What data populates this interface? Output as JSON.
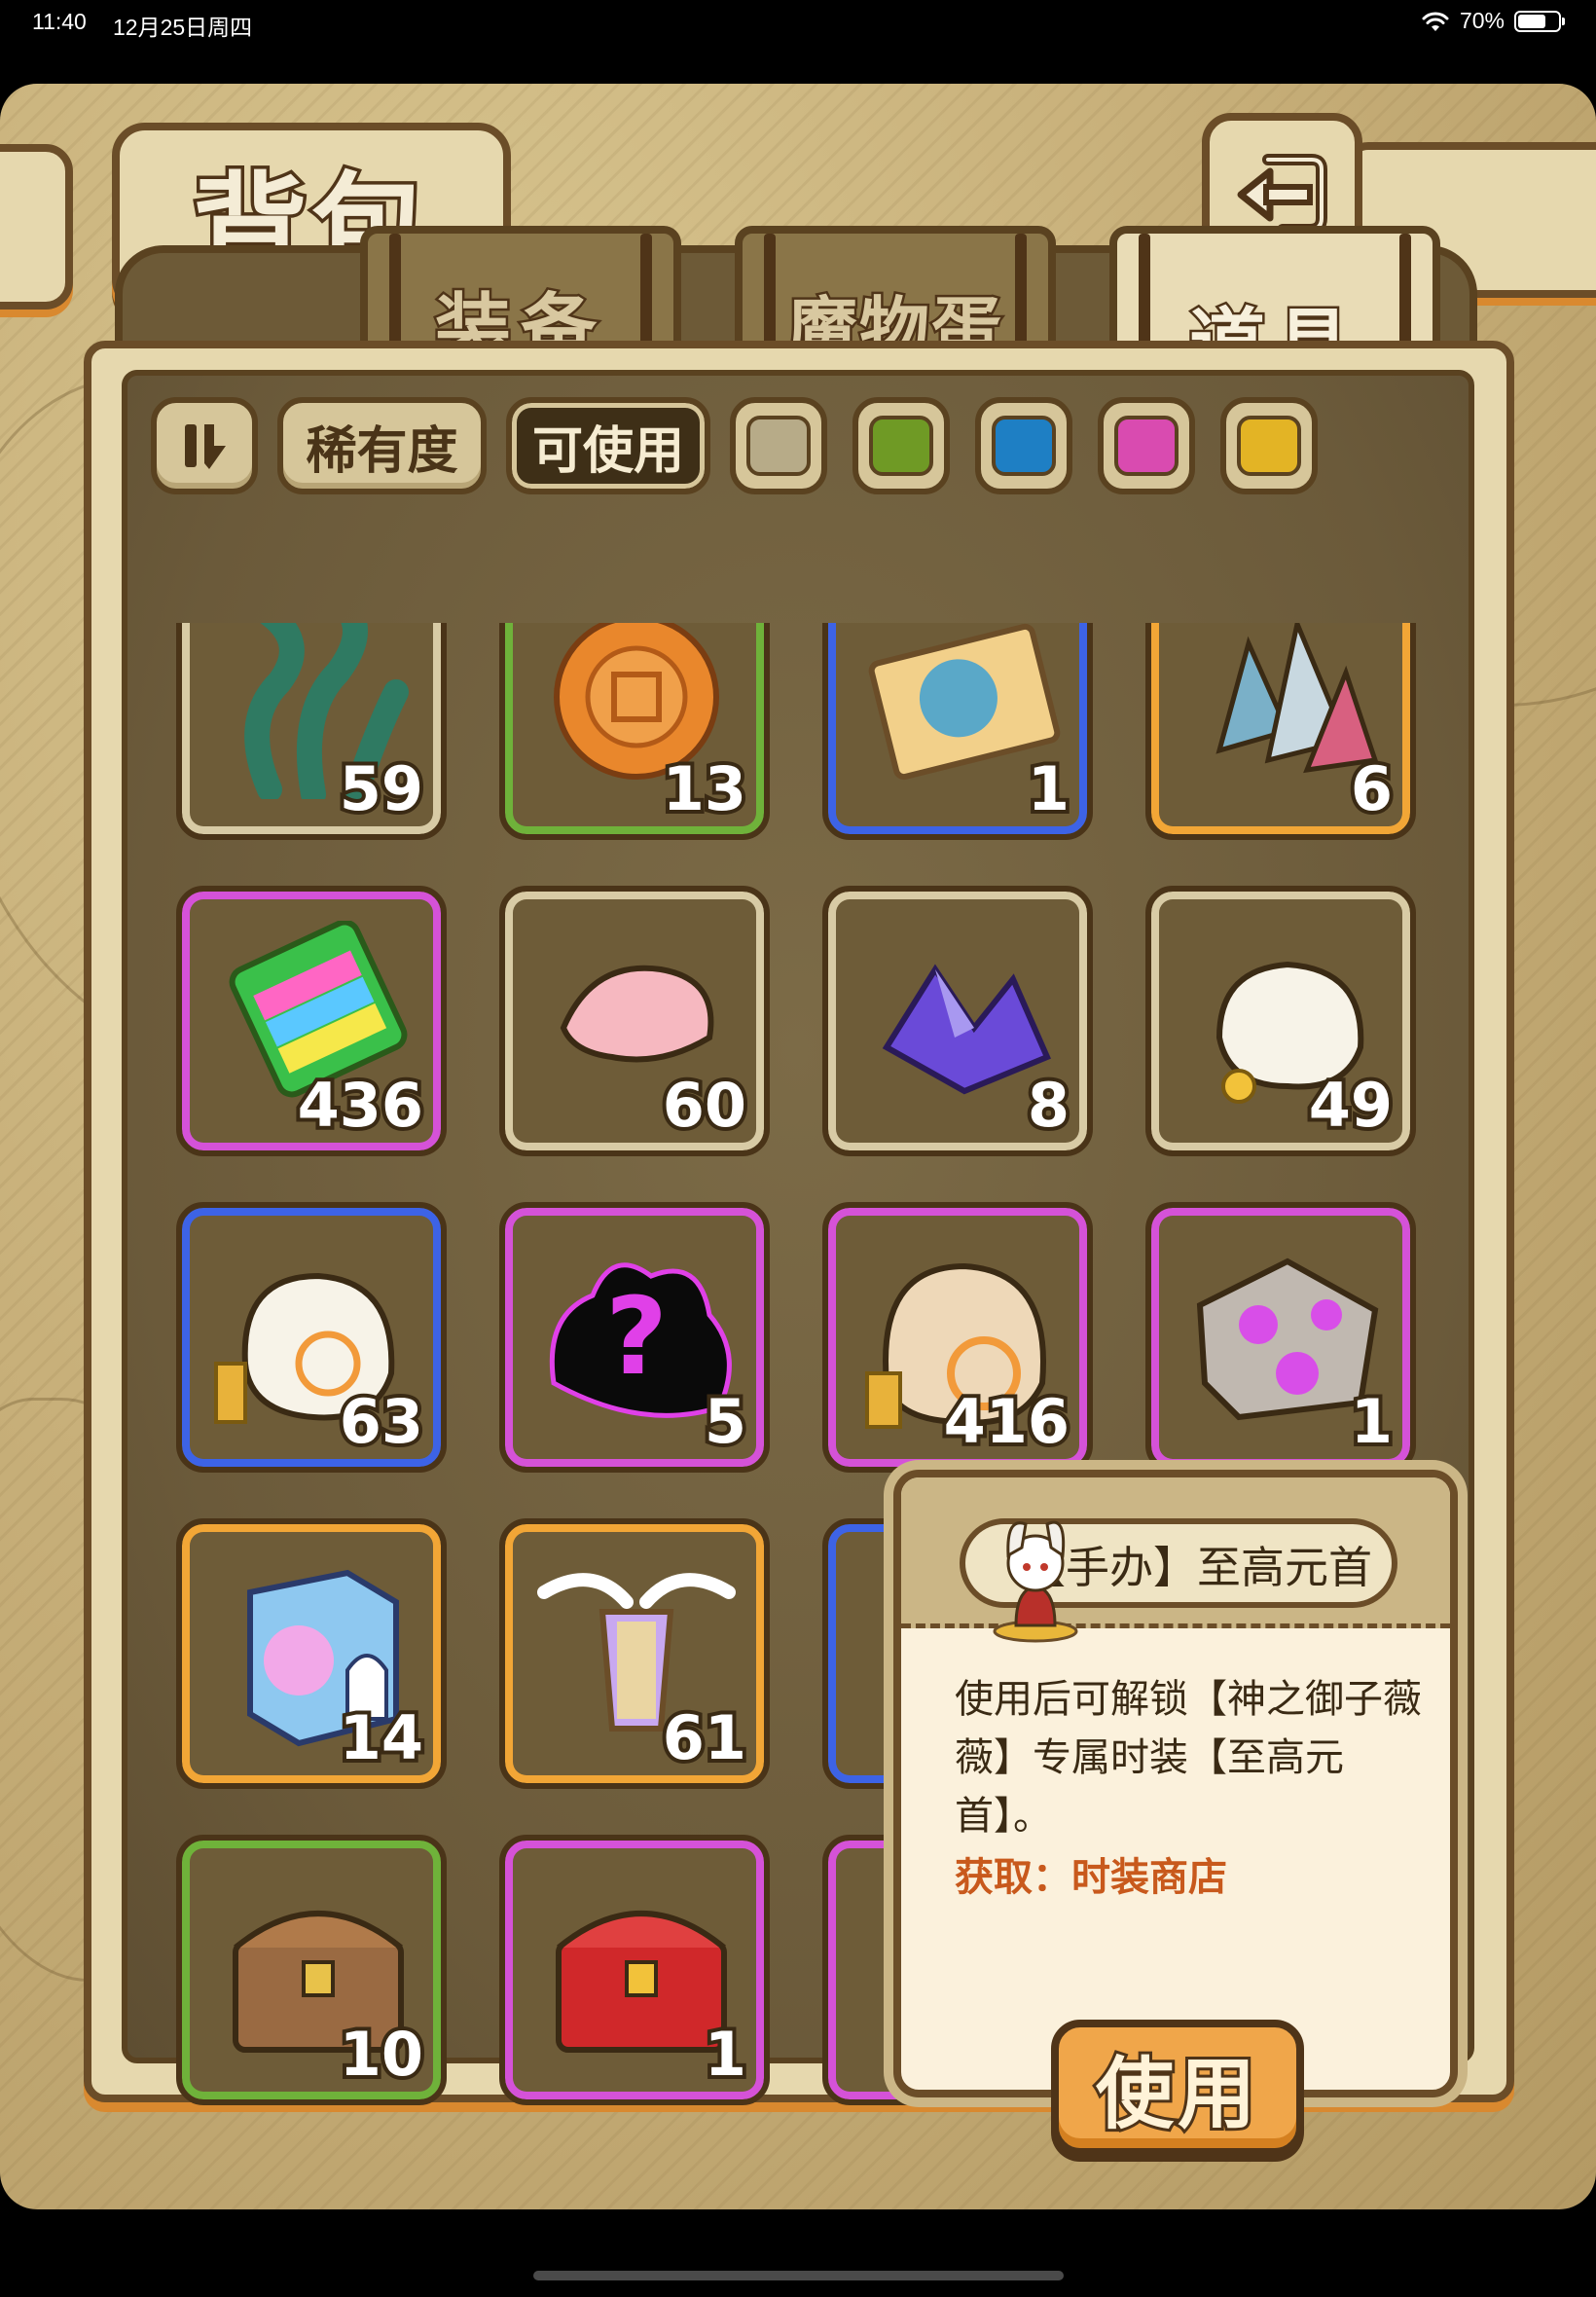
{
  "status": {
    "time": "11:40",
    "date": "12月25日周四",
    "battery": "70%",
    "battery_level": 0.7
  },
  "header": {
    "title": "背包",
    "back_icon": "return-arrow-icon"
  },
  "tabs": [
    {
      "label": "装备",
      "active": false
    },
    {
      "label": "魔物蛋",
      "active": false
    },
    {
      "label": "道具",
      "active": true
    }
  ],
  "filters": {
    "sort_icon": "sort-toggle-icon",
    "rarity_label": "稀有度",
    "usable_label": "可使用",
    "rarity_swatches": [
      "#b7ab88",
      "#6f9a25",
      "#1e7fc4",
      "#d94bb0",
      "#e3b425"
    ]
  },
  "rarity_colors": {
    "gray": "#d8cba5",
    "green": "#6fb23a",
    "blue": "#3d63e6",
    "purple": "#d552d8",
    "orange": "#f2a636"
  },
  "items": [
    {
      "icon": "seaweed-icon",
      "count": "59",
      "rarity": "gray"
    },
    {
      "icon": "mooncake-icon",
      "count": "13",
      "rarity": "green"
    },
    {
      "icon": "portrait-ticket-icon",
      "count": "1",
      "rarity": "blue"
    },
    {
      "icon": "crystal-cluster-icon",
      "count": "6",
      "rarity": "orange"
    },
    {
      "icon": "popsicle-icon",
      "count": "436",
      "rarity": "purple"
    },
    {
      "icon": "pink-petal-icon",
      "count": "60",
      "rarity": "gray"
    },
    {
      "icon": "purple-crystal-icon",
      "count": "8",
      "rarity": "gray"
    },
    {
      "icon": "small-coin-bag-icon",
      "count": "49",
      "rarity": "gray"
    },
    {
      "icon": "coin-bag-icon",
      "count": "63",
      "rarity": "blue"
    },
    {
      "icon": "mystery-silhouette-icon",
      "count": "5",
      "rarity": "purple",
      "glyph": "?"
    },
    {
      "icon": "large-coin-bag-icon",
      "count": "416",
      "rarity": "purple"
    },
    {
      "icon": "purple-ore-icon",
      "count": "1",
      "rarity": "purple"
    },
    {
      "icon": "blind-box-icon",
      "count": "14",
      "rarity": "orange"
    },
    {
      "icon": "winged-lantern-icon",
      "count": "61",
      "rarity": "orange"
    },
    {
      "icon": "blue-chest-icon",
      "count": "",
      "rarity": "blue"
    },
    {
      "icon": "",
      "count": "",
      "rarity": "orange"
    },
    {
      "icon": "wooden-chest-icon",
      "count": "10",
      "rarity": "green"
    },
    {
      "icon": "red-chest-icon",
      "count": "1",
      "rarity": "purple"
    },
    {
      "icon": "figure-icon",
      "count": "",
      "rarity": "purple"
    },
    {
      "icon": "",
      "count": "",
      "rarity": "purple"
    }
  ],
  "tooltip": {
    "title": "【手办】至高元首",
    "avatar_icon": "figure-avatar-icon",
    "description": "使用后可解锁【神之御子薇薇】专属时装【至高元首】。",
    "source": "获取：时装商店",
    "use_label": "使用"
  }
}
